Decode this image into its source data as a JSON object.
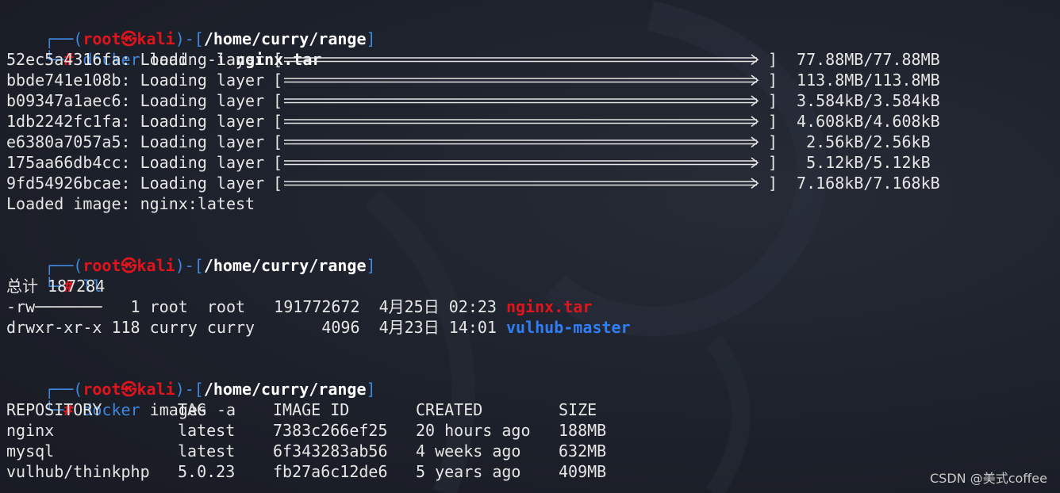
{
  "prompt": {
    "open_paren": "┌──(",
    "user": "root",
    "skull": "㉿",
    "host": "kali",
    "close_paren": ")-[",
    "path": "/home/curry/range",
    "close_bracket": "]",
    "corner": "└─",
    "hash": "#"
  },
  "blocks": [
    {
      "command": {
        "bin": "docker",
        "rest": " load  -i ",
        "arg": "nginx.tar"
      }
    },
    {
      "command": {
        "bin": "ll",
        "rest": "",
        "arg": ""
      }
    },
    {
      "command": {
        "bin": "docker",
        "rest": " images -a",
        "arg": ""
      }
    }
  ],
  "layers": [
    {
      "id": "52ec5a4316fa:",
      "label": "Loading layer",
      "size": " 77.88MB/77.88MB",
      "progress": 1.0
    },
    {
      "id": "bbde741e108b:",
      "label": "Loading layer",
      "size": " 113.8MB/113.8MB",
      "progress": 1.0
    },
    {
      "id": "b09347a1aec6:",
      "label": "Loading layer",
      "size": " 3.584kB/3.584kB",
      "progress": 1.0
    },
    {
      "id": "1db2242fc1fa:",
      "label": "Loading layer",
      "size": " 4.608kB/4.608kB",
      "progress": 1.0
    },
    {
      "id": "e6380a7057a5:",
      "label": "Loading layer",
      "size": "  2.56kB/2.56kB",
      "progress": 1.0
    },
    {
      "id": "175aa66db4cc:",
      "label": "Loading layer",
      "size": "  5.12kB/5.12kB",
      "progress": 1.0
    },
    {
      "id": "9fd54926bcae:",
      "label": "Loading layer",
      "size": " 7.168kB/7.168kB",
      "progress": 1.0
    }
  ],
  "loaded_image": "Loaded image: nginx:latest",
  "ll": {
    "total": "总计 187284",
    "rows": [
      {
        "perms": "-rw───────",
        "links": "  1",
        "owner": "root ",
        "group": "root ",
        "size": " 191772672",
        "date": "4月25日",
        "time": "02:23",
        "name": "nginx.tar",
        "kind": "file"
      },
      {
        "perms": "drwxr-xr-x",
        "links": "118",
        "owner": "curry",
        "group": "curry",
        "size": "      4096",
        "date": "4月23日",
        "time": "14:01",
        "name": "vulhub-master",
        "kind": "dir"
      }
    ]
  },
  "images": {
    "headers": [
      "REPOSITORY",
      "TAG",
      "IMAGE ID",
      "CREATED",
      "SIZE"
    ],
    "rows": [
      [
        "nginx",
        "latest",
        "7383c266ef25",
        "20 hours ago",
        "188MB"
      ],
      [
        "mysql",
        "latest",
        "6f343283ab56",
        "4 weeks ago",
        "632MB"
      ],
      [
        "vulhub/thinkphp",
        "5.0.23",
        "fb27a6c12de6",
        "5 years ago",
        "409MB"
      ]
    ]
  },
  "watermark": "CSDN @美式coffee",
  "colors": {
    "background": "#1d212b",
    "prompt_blue": "#3f86dd",
    "prompt_red": "#e0141c",
    "dir_blue": "#2f7ef5",
    "text": "#e6e6e6"
  }
}
